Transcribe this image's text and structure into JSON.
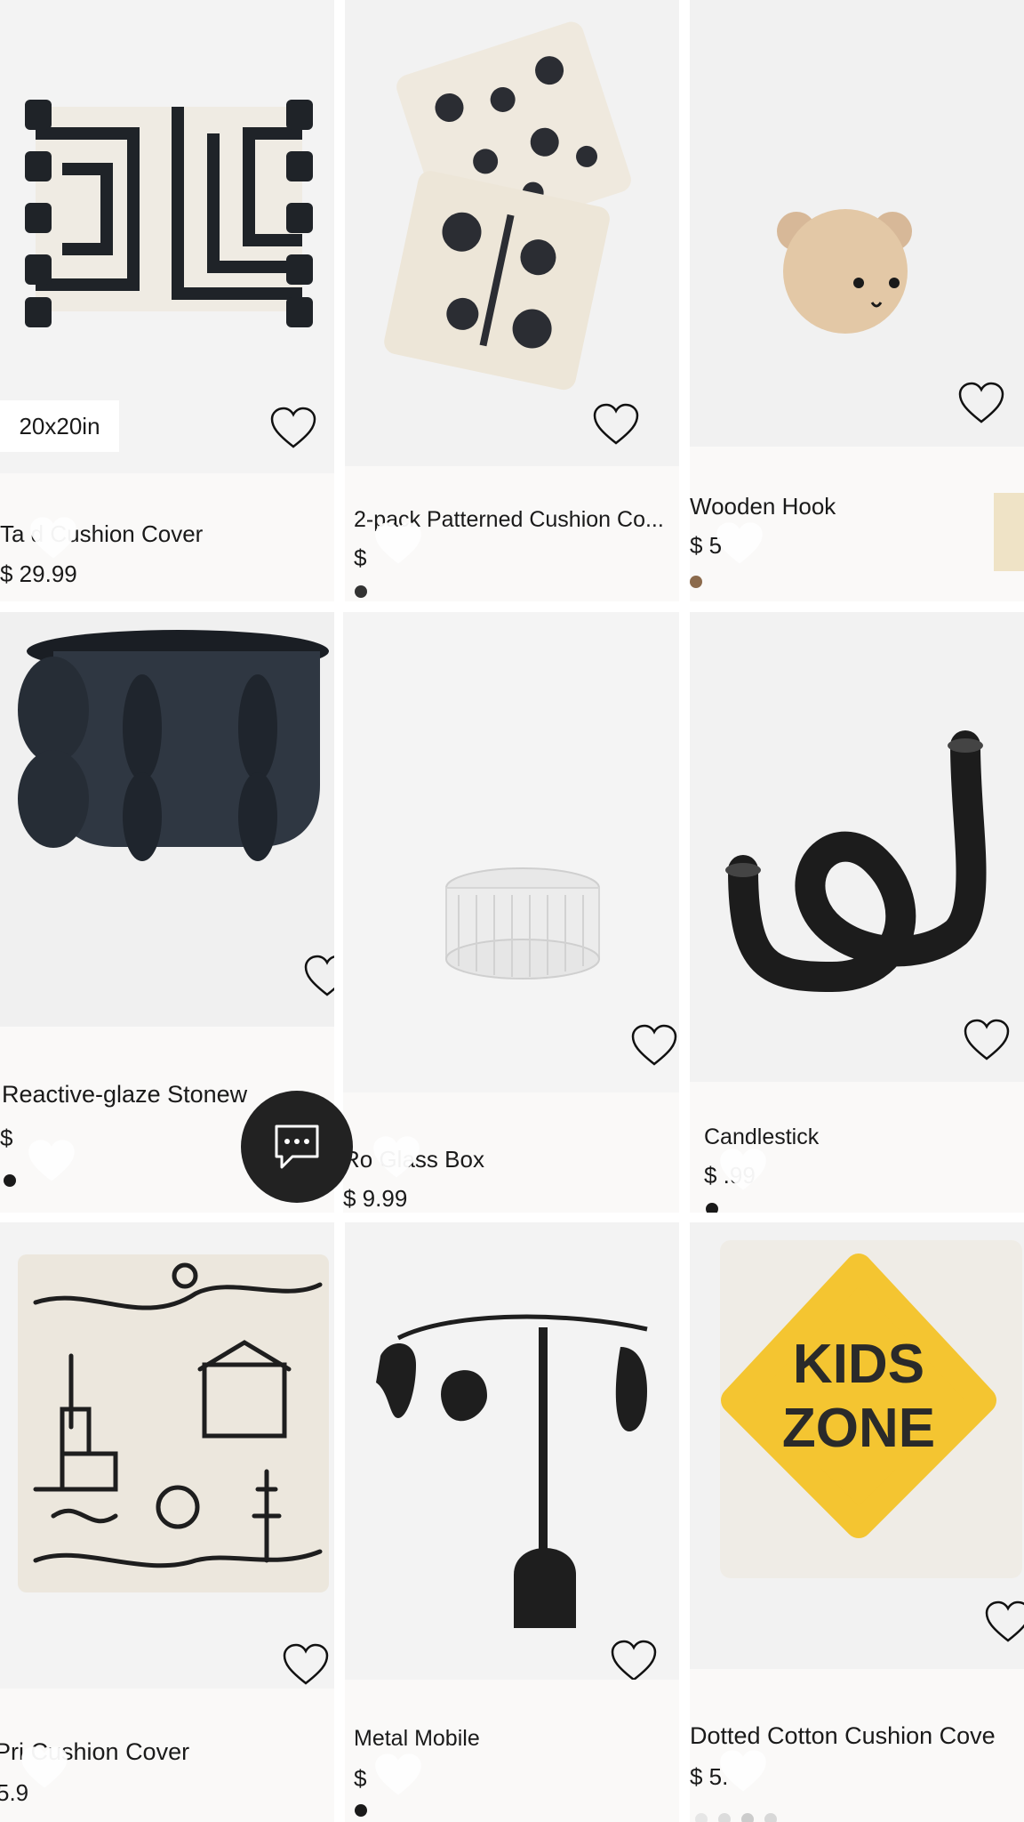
{
  "products": [
    {
      "title": "Ta d Cushion Cover",
      "price": "$ 29.99",
      "badge": "20x20in",
      "icon": "tasseled-cushion-image"
    },
    {
      "title": "2-pack Patterned Cushion Co...",
      "price": "$",
      "icon": "patterned-cushions-image"
    },
    {
      "title": "Wooden Hook",
      "price": "$ 5",
      "icon": "bear-hook-image"
    },
    {
      "title": "Reactive-glaze Stonew",
      "price": "$",
      "icon": "stoneware-pot-image"
    },
    {
      "title": "Ro Glass Box",
      "price": "$ 9.99",
      "icon": "glass-box-image"
    },
    {
      "title": "Candlestick",
      "price": "$ .99",
      "icon": "candlestick-image"
    },
    {
      "title": "Pri Cushion Cover",
      "price": "5.9",
      "icon": "printed-cushion-image"
    },
    {
      "title": "Metal Mobile",
      "price": "$",
      "icon": "metal-mobile-image"
    },
    {
      "title": "Dotted Cotton Cushion Cove",
      "price": "$ 5.",
      "icon": "kids-zone-cushion-image",
      "print": [
        "KIDS",
        "ZONE"
      ]
    }
  ],
  "colors": {
    "card_bg": "#faf9f8",
    "image_bg": "#f2f2f2",
    "swatch_dark": "#333333",
    "swatch_brown": "#8b6a4c",
    "swatch_cream": "#efe3c6",
    "chat_bg": "#222222"
  },
  "chat": {
    "icon": "chat-bubble-icon"
  }
}
